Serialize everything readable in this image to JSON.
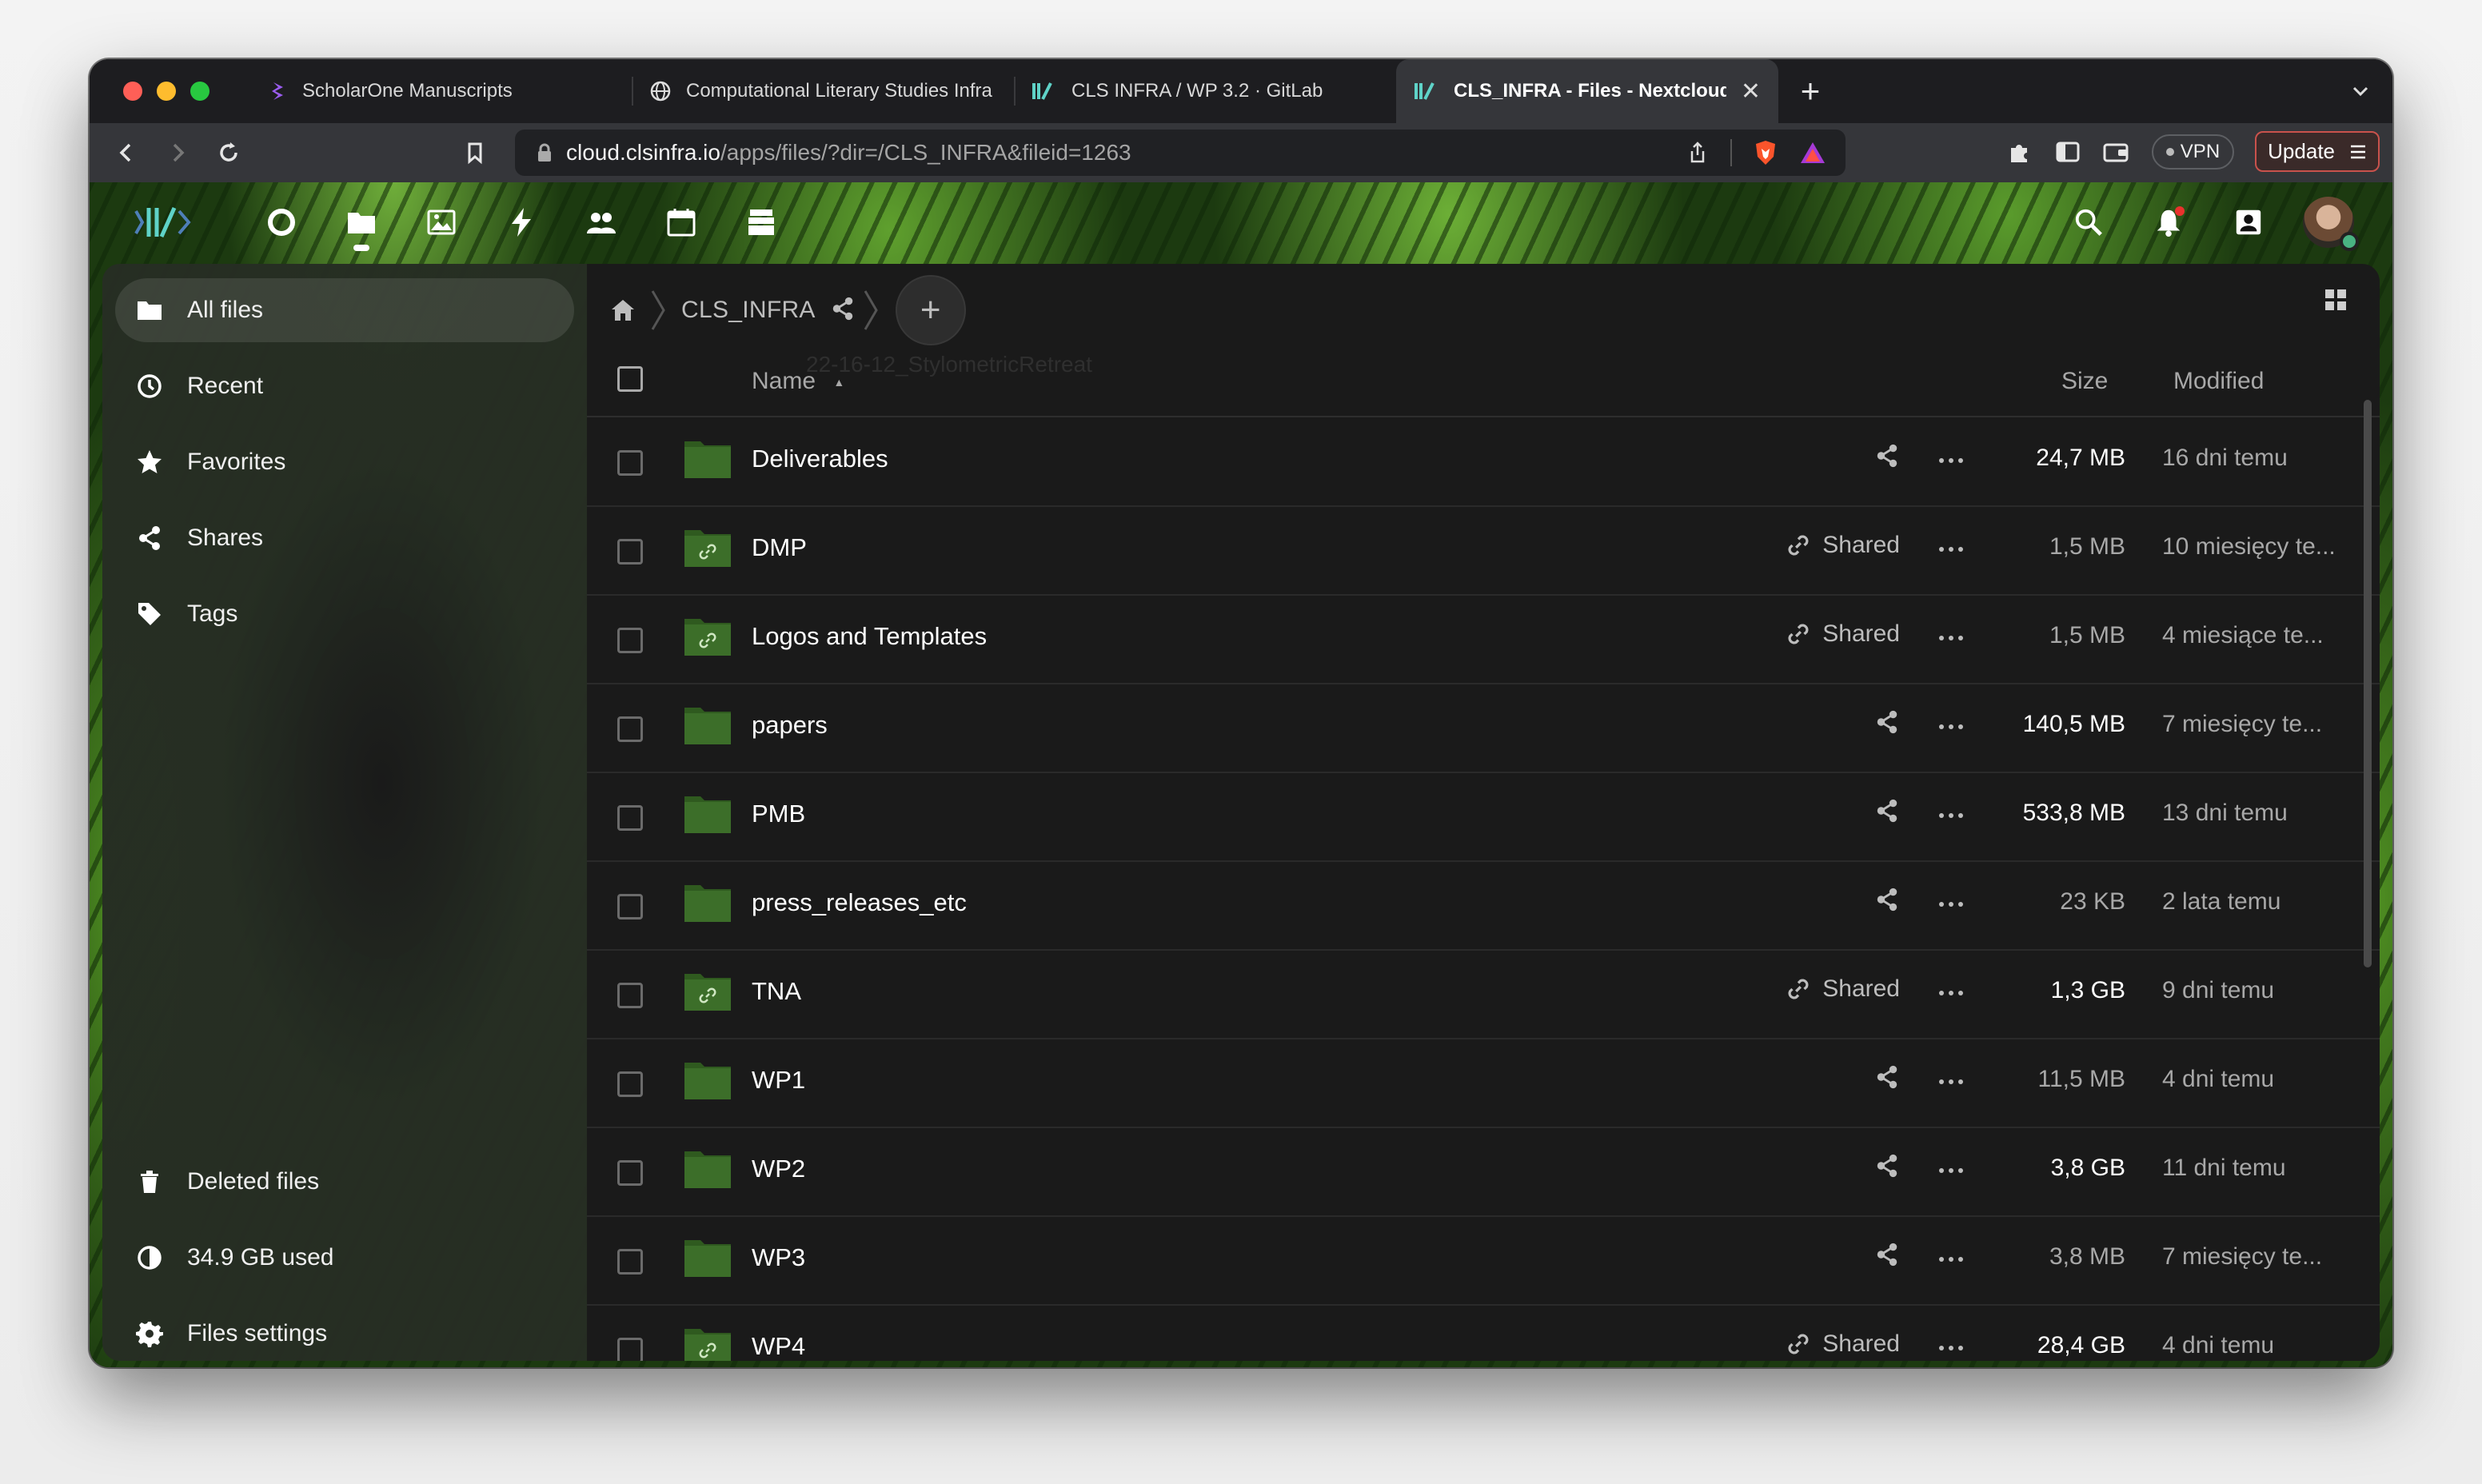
{
  "browser": {
    "tabs": [
      {
        "title": "ScholarOne Manuscripts",
        "icon": "scholarone-icon",
        "active": false
      },
      {
        "title": "Computational Literary Studies Infra",
        "icon": "globe-icon",
        "active": false
      },
      {
        "title": "CLS INFRA / WP 3.2 · GitLab",
        "icon": "clsinfra-logo-icon",
        "active": false
      },
      {
        "title": "CLS_INFRA - Files - Nextcloud",
        "icon": "clsinfra-logo-icon",
        "active": true
      }
    ],
    "close_tab": "✕",
    "new_tab": "+",
    "tab_menu": "⌄",
    "url_host": "cloud.clsinfra.io",
    "url_path": "/apps/files/?dir=/CLS_INFRA&fileid=1263",
    "vpn_label": "VPN",
    "update_label": "Update"
  },
  "header": {
    "apps": [
      "dashboard-icon",
      "files-icon",
      "photos-icon",
      "activity-icon",
      "contacts-icon",
      "calendar-icon",
      "deck-icon"
    ],
    "active_app": "files-icon"
  },
  "sidebar": {
    "items": [
      {
        "label": "All files",
        "icon": "folder-icon"
      },
      {
        "label": "Recent",
        "icon": "clock-icon"
      },
      {
        "label": "Favorites",
        "icon": "star-icon"
      },
      {
        "label": "Shares",
        "icon": "share-icon"
      },
      {
        "label": "Tags",
        "icon": "tag-icon"
      }
    ],
    "bottom": [
      {
        "label": "Deleted files",
        "icon": "trash-icon"
      },
      {
        "label": "34.9 GB used",
        "icon": "pie-icon"
      },
      {
        "label": "Files settings",
        "icon": "gear-icon"
      }
    ]
  },
  "breadcrumb": {
    "current": "CLS_INFRA",
    "add_label": "+"
  },
  "table": {
    "ghost_text": "22-16-12_StylometricRetreat",
    "columns": {
      "name": "Name",
      "name_sort": "▲",
      "size": "Size",
      "modified": "Modified"
    },
    "rows": [
      {
        "name": "Deliverables",
        "shared": false,
        "share_label": "",
        "size": "24,7 MB",
        "modified": "16 dni temu",
        "size_strong": true
      },
      {
        "name": "DMP",
        "shared": true,
        "share_label": "Shared",
        "size": "1,5 MB",
        "modified": "10 miesięcy te...",
        "size_strong": false
      },
      {
        "name": "Logos and Templates",
        "shared": true,
        "share_label": "Shared",
        "size": "1,5 MB",
        "modified": "4 miesiące te...",
        "size_strong": false
      },
      {
        "name": "papers",
        "shared": false,
        "share_label": "",
        "size": "140,5 MB",
        "modified": "7 miesięcy te...",
        "size_strong": true
      },
      {
        "name": "PMB",
        "shared": false,
        "share_label": "",
        "size": "533,8 MB",
        "modified": "13 dni temu",
        "size_strong": true
      },
      {
        "name": "press_releases_etc",
        "shared": false,
        "share_label": "",
        "size": "23 KB",
        "modified": "2 lata temu",
        "size_strong": false
      },
      {
        "name": "TNA",
        "shared": true,
        "share_label": "Shared",
        "size": "1,3 GB",
        "modified": "9 dni temu",
        "size_strong": true
      },
      {
        "name": "WP1",
        "shared": false,
        "share_label": "",
        "size": "11,5 MB",
        "modified": "4 dni temu",
        "size_strong": false
      },
      {
        "name": "WP2",
        "shared": false,
        "share_label": "",
        "size": "3,8 GB",
        "modified": "11 dni temu",
        "size_strong": true
      },
      {
        "name": "WP3",
        "shared": false,
        "share_label": "",
        "size": "3,8 MB",
        "modified": "7 miesięcy te...",
        "size_strong": false
      },
      {
        "name": "WP4",
        "shared": true,
        "share_label": "Shared",
        "size": "28,4 GB",
        "modified": "4 dni temu",
        "size_strong": true
      }
    ]
  },
  "colors": {
    "folder": "#3c6e29",
    "folder_tab": "#2f5a1f",
    "accent_red": "#e9322d"
  }
}
